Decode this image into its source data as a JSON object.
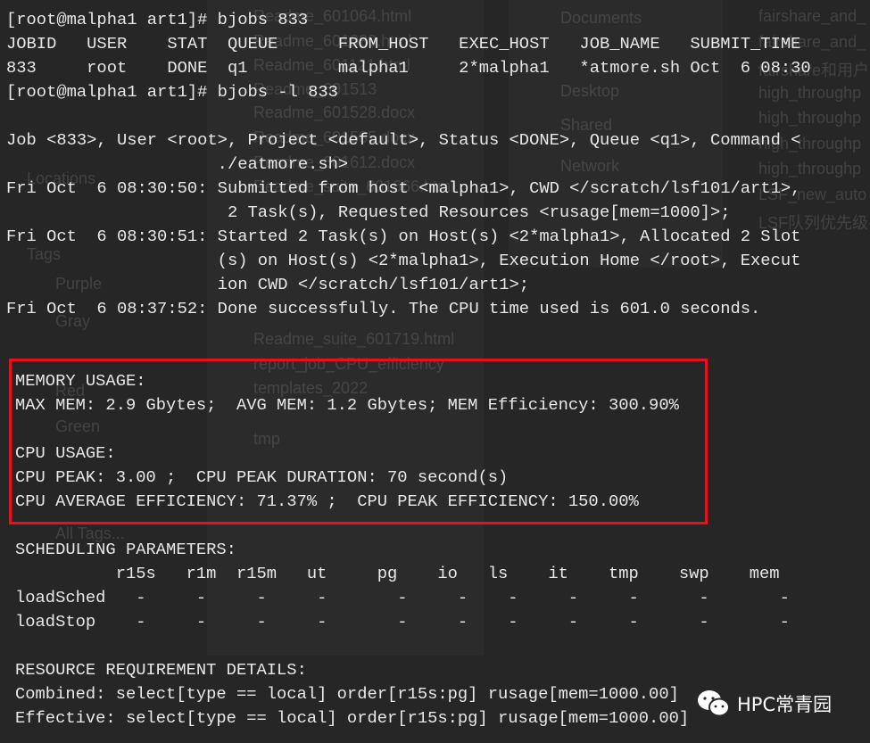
{
  "colors": {
    "background": "#262626",
    "text": "#e8e8e8",
    "highlight_box": "#e3131b"
  },
  "background_window": {
    "files": [
      "Readme_601064.html",
      "Readme_601080.html",
      "Readme_601121.html",
      "Readme_601513",
      "Readme_601528.docx",
      "Readme_601585.docx",
      "Readme_601612.docx",
      "Readme_suite_601666.html",
      "Readme_suite_601719.html",
      "report_job_CPU_efficiency",
      "templates_2022",
      "tmp"
    ],
    "sidebar": [
      "Documents",
      "Desktop",
      "Shared",
      "Network",
      "Locations",
      "Tags",
      "Purple",
      "Gray",
      "Red",
      "Green",
      "All Tags..."
    ],
    "right_files": [
      "fairshare_and_",
      "fairshare_and_",
      "fairshare和用户",
      "high_throughp",
      "high_throughp",
      "high_throughp",
      "high_throughp",
      "LSF_new_auto",
      "LSF队列优先级"
    ]
  },
  "terminal": {
    "block_a": [
      "[root@malpha1 art1]# bjobs 833",
      "JOBID   USER    STAT  QUEUE      FROM_HOST   EXEC_HOST   JOB_NAME   SUBMIT_TIME",
      "833     root    DONE  q1         malpha1     2*malpha1   *atmore.sh Oct  6 08:30",
      "[root@malpha1 art1]# bjobs -l 833",
      "",
      "Job <833>, User <root>, Project <default>, Status <DONE>, Queue <q1>, Command <",
      "                     ./eatmore.sh>",
      "Fri Oct  6 08:30:50: Submitted from host <malpha1>, CWD </scratch/lsf101/art1>,",
      "                      2 Task(s), Requested Resources <rusage[mem=1000]>;",
      "Fri Oct  6 08:30:51: Started 2 Task(s) on Host(s) <2*malpha1>, Allocated 2 Slot",
      "                     (s) on Host(s) <2*malpha1>, Execution Home </root>, Execut",
      "                     ion CWD </scratch/lsf101/art1>;",
      "Fri Oct  6 08:37:52: Done successfully. The CPU time used is 601.0 seconds."
    ],
    "block_b": [
      "MEMORY USAGE:",
      "MAX MEM: 2.9 Gbytes;  AVG MEM: 1.2 Gbytes; MEM Efficiency: 300.90%",
      "",
      "CPU USAGE:",
      "CPU PEAK: 3.00 ;  CPU PEAK DURATION: 70 second(s)",
      "CPU AVERAGE EFFICIENCY: 71.37% ;  CPU PEAK EFFICIENCY: 150.00%",
      "",
      "SCHEDULING PARAMETERS:",
      "          r15s   r1m  r15m   ut     pg    io   ls    it    tmp    swp    mem",
      "loadSched   -     -     -     -       -     -    -     -     -      -       -",
      "loadStop    -     -     -     -       -     -    -     -     -      -       -",
      "",
      "RESOURCE REQUIREMENT DETAILS:",
      "Combined: select[type == local] order[r15s:pg] rusage[mem=1000.00]",
      "Effective: select[type == local] order[r15s:pg] rusage[mem=1000.00]"
    ]
  },
  "watermark": {
    "icon": "wechat-icon",
    "text": "HPC常青园"
  }
}
